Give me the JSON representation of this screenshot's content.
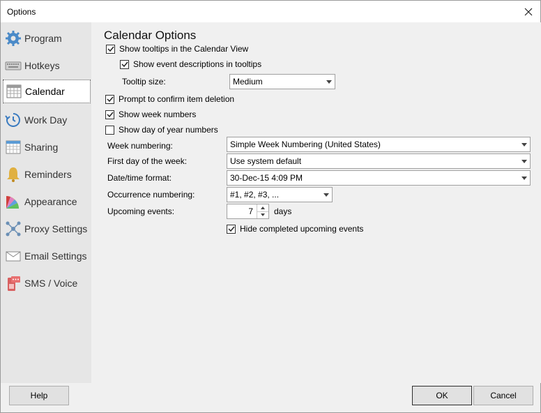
{
  "window": {
    "title": "Options"
  },
  "sidebar": {
    "items": [
      {
        "label": "Program",
        "icon": "gear-icon"
      },
      {
        "label": "Hotkeys",
        "icon": "keyboard-icon"
      },
      {
        "label": "Calendar",
        "icon": "calendar-icon"
      },
      {
        "label": "Work Day",
        "icon": "clock-icon"
      },
      {
        "label": "Sharing",
        "icon": "sharing-icon"
      },
      {
        "label": "Reminders",
        "icon": "bell-icon"
      },
      {
        "label": "Appearance",
        "icon": "palette-icon"
      },
      {
        "label": "Proxy Settings",
        "icon": "network-icon"
      },
      {
        "label": "Email Settings",
        "icon": "envelope-icon"
      },
      {
        "label": "SMS / Voice",
        "icon": "phone-icon"
      }
    ],
    "active": "Calendar"
  },
  "calendar_options": {
    "heading": "Calendar Options",
    "show_tooltips": {
      "label": "Show tooltips in the Calendar View",
      "checked": true
    },
    "show_event_descriptions": {
      "label": "Show event descriptions in tooltips",
      "checked": true
    },
    "tooltip_size": {
      "label": "Tooltip size:",
      "value": "Medium"
    },
    "prompt_confirm_deletion": {
      "label": "Prompt to confirm item deletion",
      "checked": true
    },
    "show_week_numbers": {
      "label": "Show week numbers",
      "checked": true
    },
    "show_day_of_year": {
      "label": "Show day of year numbers",
      "checked": false
    },
    "week_numbering": {
      "label": "Week numbering:",
      "value": "Simple Week Numbering (United States)"
    },
    "first_day_of_week": {
      "label": "First day of the week:",
      "value": "Use system default"
    },
    "datetime_format": {
      "label": "Date/time format:",
      "value": "30-Dec-15 4:09 PM"
    },
    "occurrence_numbering": {
      "label": "Occurrence numbering:",
      "value": "#1, #2, #3, ..."
    },
    "upcoming_events": {
      "label": "Upcoming events:",
      "value": "7",
      "unit": "days"
    },
    "hide_completed": {
      "label": "Hide completed upcoming events",
      "checked": true
    }
  },
  "buttons": {
    "help": "Help",
    "ok": "OK",
    "cancel": "Cancel"
  }
}
